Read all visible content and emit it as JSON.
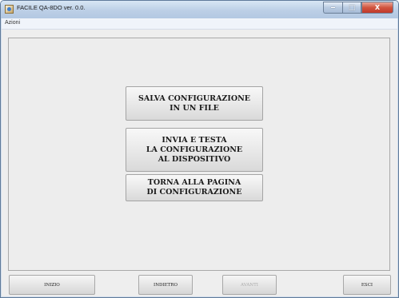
{
  "window": {
    "title": "FACILE QA-8DO ver. 0.0.",
    "controls": {
      "minimize": "‒",
      "maximize": "□",
      "close": "X"
    }
  },
  "menubar": {
    "items": [
      {
        "label": "Azioni"
      }
    ]
  },
  "actions": {
    "save": "SALVA CONFIGURAZIONE\nIN UN FILE",
    "send_test": "INVIA E TESTA\nLA CONFIGURAZIONE\nAL DISPOSITIVO",
    "back_config": "TORNA ALLA PAGINA\nDI CONFIGURAZIONE"
  },
  "navigation": {
    "start": "INIZIO",
    "back": "INDIETRO",
    "forward": "AVANTI",
    "forward_enabled": false,
    "exit": "ESCI"
  }
}
